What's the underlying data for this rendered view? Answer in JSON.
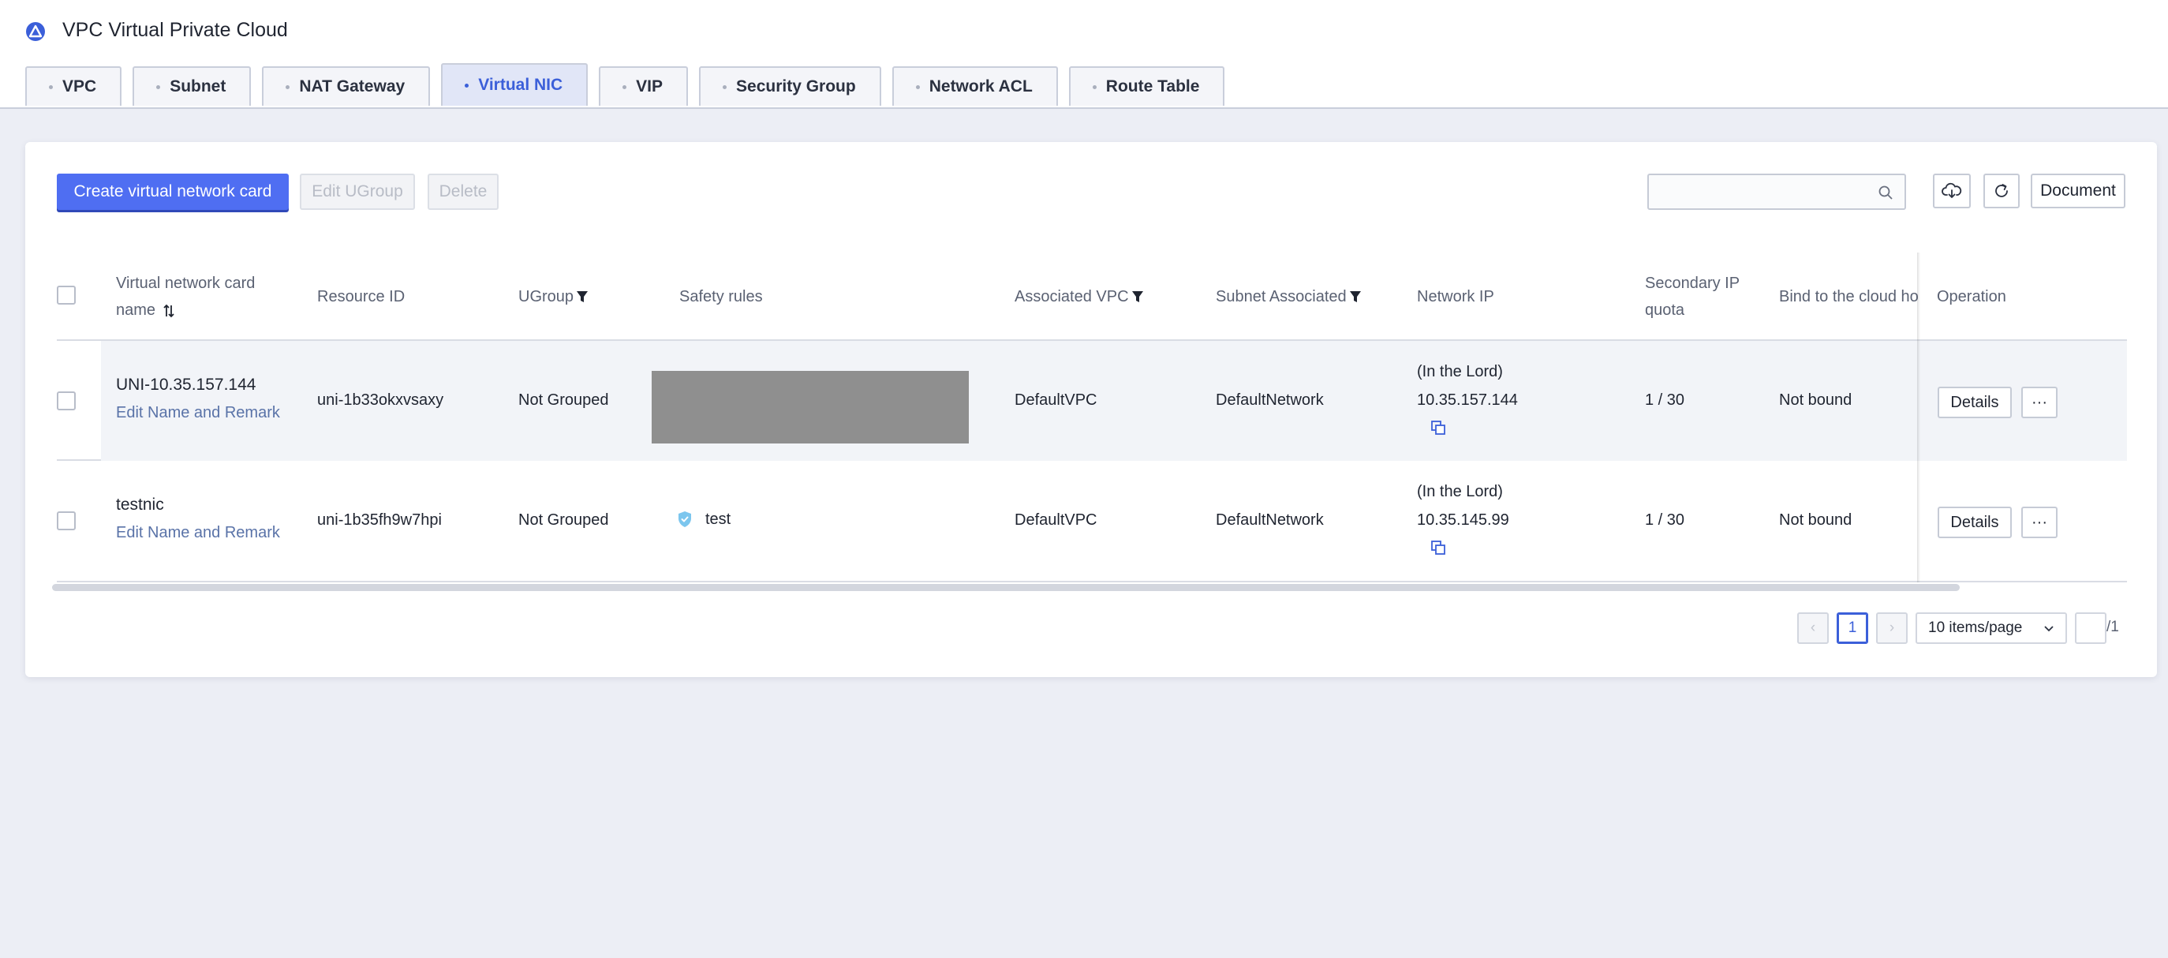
{
  "app": {
    "title": "VPC Virtual Private Cloud",
    "logo_icon": "vpc-triangle-logo-icon",
    "accent_color": "#3b5fd9"
  },
  "tabs": [
    {
      "label": "VPC",
      "active": false
    },
    {
      "label": "Subnet",
      "active": false
    },
    {
      "label": "NAT Gateway",
      "active": false
    },
    {
      "label": "Virtual NIC",
      "active": true
    },
    {
      "label": "VIP",
      "active": false
    },
    {
      "label": "Security Group",
      "active": false
    },
    {
      "label": "Network ACL",
      "active": false
    },
    {
      "label": "Route Table",
      "active": false
    }
  ],
  "toolbar": {
    "create_label": "Create virtual network card",
    "edit_ugroup_label": "Edit UGroup",
    "delete_label": "Delete",
    "search_placeholder": "",
    "document_label": "Document",
    "download_icon": "cloud-download-icon",
    "refresh_icon": "refresh-icon"
  },
  "table": {
    "headers": {
      "name_line1": "Virtual network card",
      "name_line2": "name",
      "resource_id": "Resource ID",
      "ugroup": "UGroup",
      "safety_rules": "Safety rules",
      "associated_vpc": "Associated VPC",
      "subnet_associated": "Subnet Associated",
      "network_ip": "Network IP",
      "secondary_ip_line1": "Secondary IP",
      "secondary_ip_line2": "quota",
      "bind_host": "Bind to the cloud ho",
      "operation": "Operation"
    },
    "rows": [
      {
        "name": "UNI-10.35.157.144",
        "edit_link": "Edit Name and Remark",
        "resource_id": "uni-1b33okxvsaxy",
        "ugroup": "Not Grouped",
        "safety_rule": "",
        "associated_vpc": "DefaultVPC",
        "subnet": "DefaultNetwork",
        "ip_label": "(In the Lord)",
        "ip": "10.35.157.144",
        "quota": "1 / 30",
        "bind": "Not bound",
        "details_label": "Details",
        "more_label": "···"
      },
      {
        "name": "testnic",
        "edit_link": "Edit Name and Remark",
        "resource_id": "uni-1b35fh9w7hpi",
        "ugroup": "Not Grouped",
        "safety_rule": "test",
        "associated_vpc": "DefaultVPC",
        "subnet": "DefaultNetwork",
        "ip_label": "(In the Lord)",
        "ip": "10.35.145.99",
        "quota": "1 / 30",
        "bind": "Not bound",
        "details_label": "Details",
        "more_label": "···"
      }
    ]
  },
  "pagination": {
    "prev": "‹",
    "current_page": "1",
    "next": "›",
    "page_size": "10 items/page",
    "jump_value": "",
    "total_pages": "/1"
  }
}
